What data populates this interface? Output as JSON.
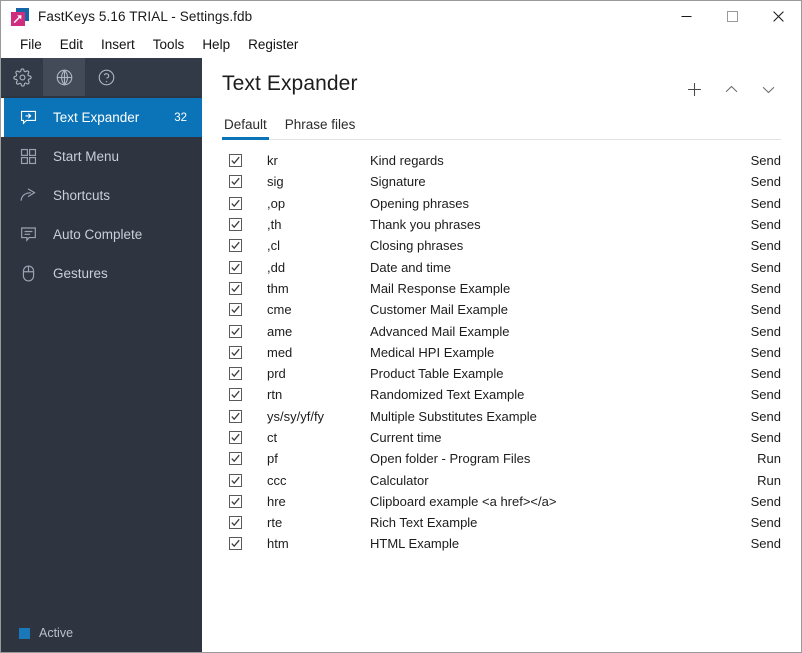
{
  "window": {
    "title": "FastKeys 5.16 TRIAL - Settings.fdb",
    "app_icon": "fastkeys-logo-icon",
    "controls": {
      "minimize": "minimize-icon",
      "maximize": "maximize-icon",
      "close": "close-icon"
    }
  },
  "menubar": {
    "items": [
      {
        "label": "File"
      },
      {
        "label": "Edit"
      },
      {
        "label": "Insert"
      },
      {
        "label": "Tools"
      },
      {
        "label": "Help"
      },
      {
        "label": "Register"
      }
    ]
  },
  "sidebar": {
    "toolbar": [
      {
        "icon": "gear-icon",
        "active": false
      },
      {
        "icon": "globe-icon",
        "active": true
      },
      {
        "icon": "help-circle-icon",
        "active": false
      }
    ],
    "items": [
      {
        "label": "Text Expander",
        "icon": "speech-bubble-arrow-icon",
        "badge": "32",
        "selected": true
      },
      {
        "label": "Start Menu",
        "icon": "grid-squares-icon",
        "badge": "",
        "selected": false
      },
      {
        "label": "Shortcuts",
        "icon": "curved-arrow-icon",
        "badge": "",
        "selected": false
      },
      {
        "label": "Auto Complete",
        "icon": "speech-bubble-lines-icon",
        "badge": "",
        "selected": false
      },
      {
        "label": "Gestures",
        "icon": "mouse-icon",
        "badge": "",
        "selected": false
      }
    ],
    "status": {
      "label": "Active",
      "color": "#1878b8"
    }
  },
  "main": {
    "title": "Text Expander",
    "actions": [
      {
        "icon": "plus-icon",
        "name": "add-phrase-button"
      },
      {
        "icon": "chevron-up-icon",
        "name": "move-up-button"
      },
      {
        "icon": "chevron-down-icon",
        "name": "move-down-button"
      }
    ],
    "tabs": [
      {
        "label": "Default",
        "active": true
      },
      {
        "label": "Phrase files",
        "active": false
      }
    ],
    "accent_color": "#0b74b8",
    "rows": [
      {
        "checked": true,
        "abbr": "kr",
        "desc": "Kind regards",
        "action": "Send"
      },
      {
        "checked": true,
        "abbr": "sig",
        "desc": "Signature",
        "action": "Send"
      },
      {
        "checked": true,
        "abbr": ",op",
        "desc": "Opening phrases",
        "action": "Send"
      },
      {
        "checked": true,
        "abbr": ",th",
        "desc": "Thank you phrases",
        "action": "Send"
      },
      {
        "checked": true,
        "abbr": ",cl",
        "desc": "Closing phrases",
        "action": "Send"
      },
      {
        "checked": true,
        "abbr": ",dd",
        "desc": "Date and time",
        "action": "Send"
      },
      {
        "checked": true,
        "abbr": "thm",
        "desc": "Mail Response Example",
        "action": "Send"
      },
      {
        "checked": true,
        "abbr": "cme",
        "desc": "Customer Mail Example",
        "action": "Send"
      },
      {
        "checked": true,
        "abbr": "ame",
        "desc": "Advanced Mail Example",
        "action": "Send"
      },
      {
        "checked": true,
        "abbr": "med",
        "desc": "Medical HPI Example",
        "action": "Send"
      },
      {
        "checked": true,
        "abbr": "prd",
        "desc": "Product Table Example",
        "action": "Send"
      },
      {
        "checked": true,
        "abbr": "rtn",
        "desc": "Randomized Text Example",
        "action": "Send"
      },
      {
        "checked": true,
        "abbr": "ys/sy/yf/fy",
        "desc": "Multiple Substitutes Example",
        "action": "Send"
      },
      {
        "checked": true,
        "abbr": "ct",
        "desc": "Current time",
        "action": "Send"
      },
      {
        "checked": true,
        "abbr": "pf",
        "desc": "Open folder - Program Files",
        "action": "Run"
      },
      {
        "checked": true,
        "abbr": "ccc",
        "desc": "Calculator",
        "action": "Run"
      },
      {
        "checked": true,
        "abbr": "hre",
        "desc": "Clipboard example <a href></a>",
        "action": "Send"
      },
      {
        "checked": true,
        "abbr": "rte",
        "desc": "Rich Text Example",
        "action": "Send"
      },
      {
        "checked": true,
        "abbr": "htm",
        "desc": "HTML Example",
        "action": "Send"
      }
    ]
  }
}
